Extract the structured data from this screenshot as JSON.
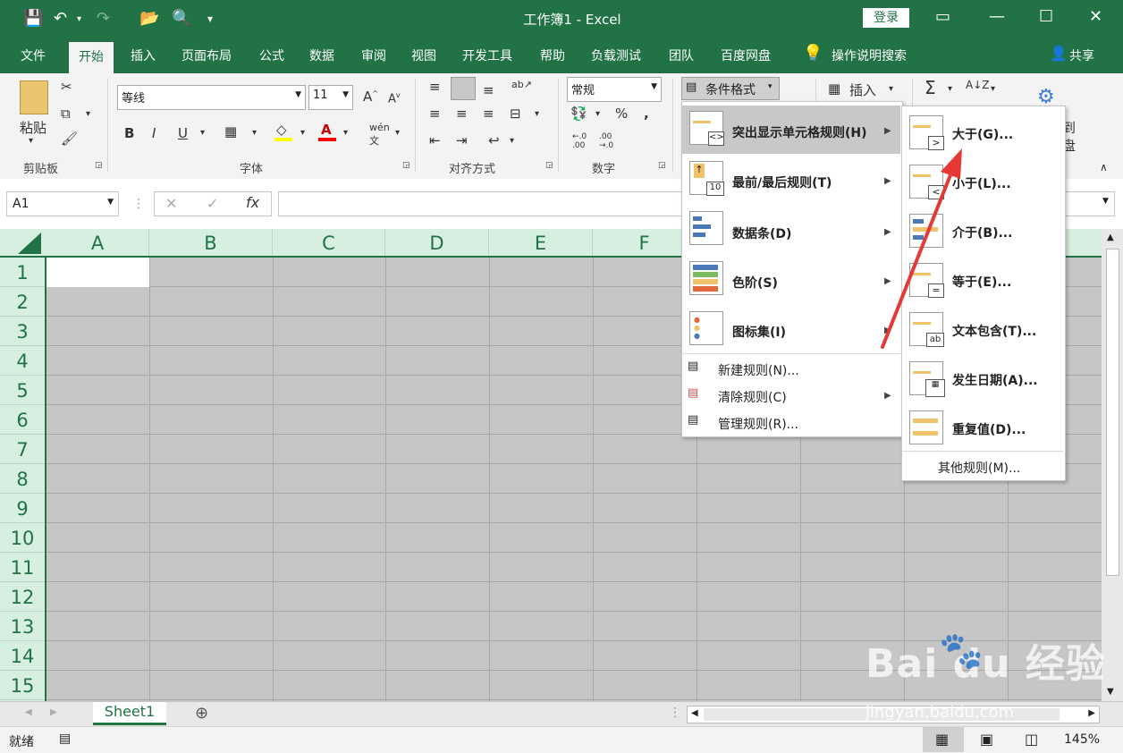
{
  "titlebar": {
    "title": "工作簿1  -  Excel",
    "login": "登录"
  },
  "tabs": [
    "文件",
    "开始",
    "插入",
    "页面布局",
    "公式",
    "数据",
    "审阅",
    "视图",
    "开发工具",
    "帮助",
    "负载测试",
    "团队",
    "百度网盘"
  ],
  "tell_me": "操作说明搜索",
  "share": "共享",
  "ribbon": {
    "paste": "粘贴",
    "clipboard": "剪贴板",
    "font_name": "等线",
    "font_size": "11",
    "font_group": "字体",
    "bold": "B",
    "italic": "I",
    "underline": "U",
    "align_group": "对齐方式",
    "number_format": "常规",
    "number_group": "数字",
    "percent": "%",
    "dec_inc": ".0\n.00",
    "cond_format": "条件格式",
    "insert": "插入",
    "partial_1": "到",
    "partial_2": "盘"
  },
  "namebox": "A1",
  "columns": [
    "A",
    "B",
    "C",
    "D",
    "E",
    "F"
  ],
  "rows": [
    "1",
    "2",
    "3",
    "4",
    "5",
    "6",
    "7",
    "8",
    "9",
    "10",
    "11",
    "12",
    "13",
    "14",
    "15"
  ],
  "sheet": "Sheet1",
  "status": {
    "ready": "就绪",
    "zoom": "145%"
  },
  "menu1": [
    {
      "label": "突出显示单元格规则(H)",
      "has_sub": true
    },
    {
      "label": "最前/最后规则(T)",
      "has_sub": true
    },
    {
      "label": "数据条(D)",
      "has_sub": true
    },
    {
      "label": "色阶(S)",
      "has_sub": true
    },
    {
      "label": "图标集(I)",
      "has_sub": true
    }
  ],
  "menu1_small": [
    {
      "label": "新建规则(N)..."
    },
    {
      "label": "清除规则(C)",
      "has_sub": true
    },
    {
      "label": "管理规则(R)..."
    }
  ],
  "menu2": [
    {
      "label": "大于(G)...",
      "glyph": ">"
    },
    {
      "label": "小于(L)...",
      "glyph": "<"
    },
    {
      "label": "介于(B)...",
      "glyph": ""
    },
    {
      "label": "等于(E)...",
      "glyph": "="
    },
    {
      "label": "文本包含(T)...",
      "glyph": "ab"
    },
    {
      "label": "发生日期(A)...",
      "glyph": ""
    },
    {
      "label": "重复值(D)...",
      "glyph": ""
    }
  ],
  "menu2_more": "其他规则(M)...",
  "watermark": {
    "brand": "Bai du 经验",
    "url": "jingyan.baidu.com"
  },
  "colors": {
    "excel_green": "#217346",
    "header_green": "#d6efe1",
    "arrow_red": "#e53935"
  }
}
